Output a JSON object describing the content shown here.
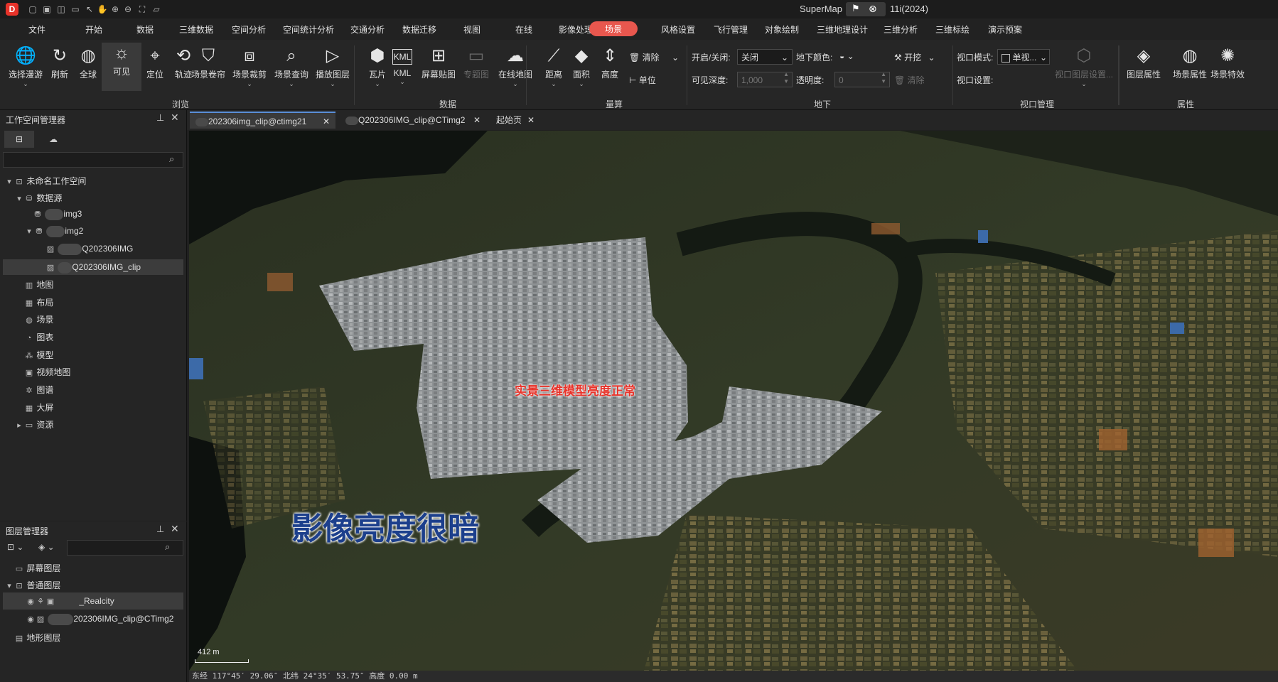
{
  "titlebar": {
    "app_title": "SuperMap",
    "version": "11i(2024)"
  },
  "menu": [
    "文件",
    "开始",
    "数据",
    "三维数据",
    "空间分析",
    "空间统计分析",
    "交通分析",
    "数据迁移",
    "视图",
    "在线",
    "影像处理",
    "场景",
    "风格设置",
    "飞行管理",
    "对象绘制",
    "三维地理设计",
    "三维分析",
    "三维标绘",
    "演示预案"
  ],
  "menu_active": "场景",
  "ribbon": {
    "browse": {
      "group": "浏览",
      "buttons": [
        "选择漫游",
        "刷新",
        "全球",
        "可见",
        "定位",
        "轨迹",
        "场景卷帘",
        "场景裁剪",
        "场景查询",
        "播放图层"
      ]
    },
    "data": {
      "group": "数据",
      "buttons": [
        "瓦片",
        "KML",
        "屏幕贴图",
        "专题图",
        "在线地图"
      ]
    },
    "measure": {
      "group": "量算",
      "buttons": [
        "距离",
        "面积",
        "高度"
      ],
      "clear": "清除",
      "unit": "单位"
    },
    "underground": {
      "group": "地下",
      "toggle_label": "开启/关闭:",
      "toggle_value": "关闭",
      "color_label": "地下颜色:",
      "excavate": "开挖",
      "depth_label": "可见深度:",
      "depth_value": "1,000",
      "transparency_label": "透明度:",
      "transparency_value": "0",
      "clear": "清除"
    },
    "viewport": {
      "group": "视口管理",
      "mode_label": "视口模式:",
      "mode_value": "单视...",
      "settings_label": "视口设置:",
      "layer_settings": "视口图层设置..."
    },
    "properties": {
      "group": "属性",
      "buttons": [
        "图层属性",
        "场景属性",
        "场景特效"
      ]
    }
  },
  "workspace": {
    "title": "工作空间管理器",
    "root": "未命名工作空间",
    "datasources": "数据源",
    "ds1": "img3",
    "ds2": "img2",
    "ds2_child1": "Q202306IMG",
    "ds2_child2": "Q202306IMG_clip",
    "maps": "地图",
    "layouts": "布局",
    "scenes": "场景",
    "charts": "图表",
    "models": "模型",
    "video_maps": "视频地图",
    "graphs": "图谱",
    "big_screen": "大屏",
    "resources": "资源"
  },
  "layer_manager": {
    "title": "图层管理器",
    "screen_layers": "屏幕图层",
    "normal_layers": "普通图层",
    "layer1": "_Realcity",
    "layer2": "202306IMG_clip@CTimg2",
    "terrain_layers": "地形图层"
  },
  "tabs": [
    "202306img_clip@ctimg21",
    "Q202306IMG_clip@CTimg2",
    "起始页"
  ],
  "map": {
    "annotation_model": "实景三维模型亮度正常",
    "annotation_image": "影像亮度很暗",
    "scale_text": "412 m",
    "status": "东经 117°45′ 29.06″  北纬 24°35′ 53.75″  高度 0.00 m"
  },
  "colors": {
    "accent": "#e8574e",
    "annotation_red": "#e8332a",
    "annotation_blue": "#1c3f8c"
  }
}
